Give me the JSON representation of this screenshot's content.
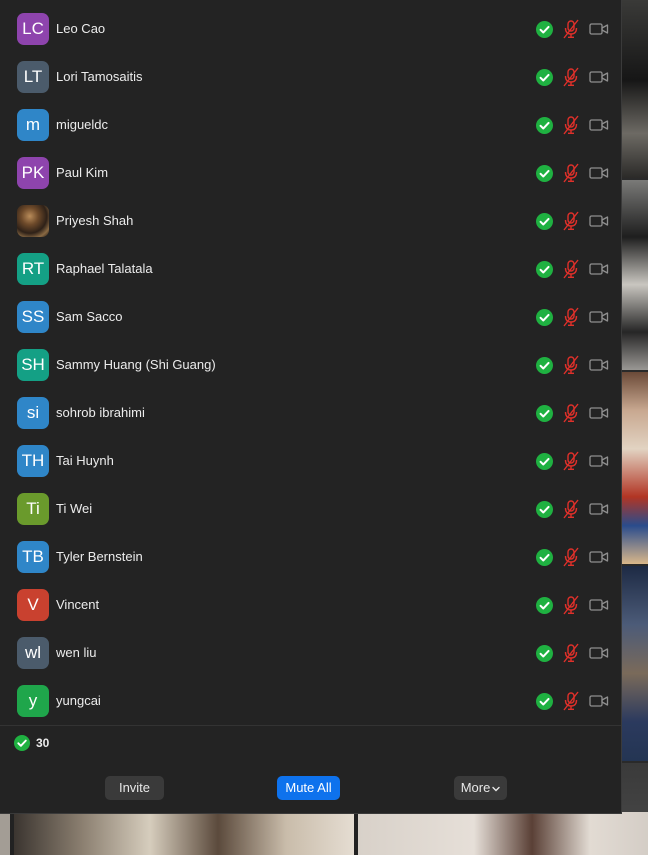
{
  "colors": {
    "panel_bg": "#232323",
    "text": "#ececec",
    "status_green": "#1fb141",
    "muted_red": "#e0302a",
    "primary_blue": "#0e72ed"
  },
  "participants": [
    {
      "initials": "LC",
      "name": "Leo Cao",
      "avatar_color": "#8e44ad",
      "photo": false
    },
    {
      "initials": "LT",
      "name": "Lori Tamosaitis",
      "avatar_color": "#4b5b6b",
      "photo": false
    },
    {
      "initials": "m",
      "name": "migueldc",
      "avatar_color": "#2f86c8",
      "photo": false
    },
    {
      "initials": "PK",
      "name": "Paul Kim",
      "avatar_color": "#8e44ad",
      "photo": false
    },
    {
      "initials": "",
      "name": "Priyesh Shah",
      "avatar_color": "#4a3526",
      "photo": true
    },
    {
      "initials": "RT",
      "name": "Raphael Talatala",
      "avatar_color": "#14a085",
      "photo": false
    },
    {
      "initials": "SS",
      "name": "Sam Sacco",
      "avatar_color": "#2f86c8",
      "photo": false
    },
    {
      "initials": "SH",
      "name": "Sammy Huang (Shi Guang)",
      "avatar_color": "#14a085",
      "photo": false
    },
    {
      "initials": "si",
      "name": "sohrob ibrahimi",
      "avatar_color": "#2f86c8",
      "photo": false
    },
    {
      "initials": "TH",
      "name": "Tai Huynh",
      "avatar_color": "#2f86c8",
      "photo": false
    },
    {
      "initials": "Ti",
      "name": "Ti Wei",
      "avatar_color": "#6a9a2c",
      "photo": false
    },
    {
      "initials": "TB",
      "name": "Tyler Bernstein",
      "avatar_color": "#2f86c8",
      "photo": false
    },
    {
      "initials": "V",
      "name": "Vincent",
      "avatar_color": "#c9412f",
      "photo": false
    },
    {
      "initials": "wl",
      "name": "wen liu",
      "avatar_color": "#4b5b6b",
      "photo": false
    },
    {
      "initials": "y",
      "name": "yungcai",
      "avatar_color": "#1fa64b",
      "photo": false
    }
  ],
  "row_icons": [
    "check-circle-icon",
    "mic-muted-icon",
    "camera-off-icon"
  ],
  "summary": {
    "icon": "check-circle-icon",
    "count": "30"
  },
  "buttons": {
    "invite": "Invite",
    "mute_all": "Mute All",
    "more": "More",
    "more_icon": "chevron-down-icon"
  }
}
